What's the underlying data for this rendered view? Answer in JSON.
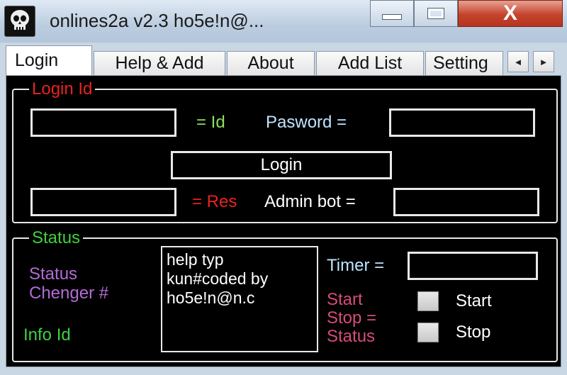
{
  "window": {
    "title": "onlines2a v2.3 ho5e!n@...",
    "icon": "skull-icon",
    "buttons": {
      "minimize": "minimize-icon",
      "maximize": "maximize-icon",
      "close": "X"
    }
  },
  "tabs": [
    {
      "label": "Login",
      "active": true
    },
    {
      "label": "Help & Add",
      "active": false
    },
    {
      "label": "About",
      "active": false
    },
    {
      "label": "Add List",
      "active": false
    },
    {
      "label": "Setting",
      "active": false
    }
  ],
  "tab_scroll": {
    "left": "◄",
    "right": "►"
  },
  "login_group": {
    "legend": "Login Id",
    "id_input": "",
    "id_label": "= Id",
    "password_label": "Pasword =",
    "password_input": "",
    "login_button": "Login",
    "res_input": "",
    "res_label": "= Res",
    "admin_label": "Admin bot =",
    "admin_input": ""
  },
  "status_group": {
    "legend": "Status",
    "status_changer_line1": "Status",
    "status_changer_line2": "Chenger #",
    "info_label": "Info Id",
    "memo_lines": [
      "help typ",
      "kun#coded by",
      "ho5e!n@n.c"
    ],
    "timer_label": "Timer =",
    "timer_input": "",
    "start_stop_line1": "Start",
    "start_stop_line2": "Stop =",
    "start_stop_line3": "Status",
    "start_checkbox_label": "Start",
    "stop_checkbox_label": "Stop"
  },
  "colors": {
    "legend_red": "#e8231e",
    "green": "#3fd13f",
    "id_green": "#8be05a",
    "purple": "#b46bd6",
    "pink": "#d84b7a",
    "label_blue": "#bfe4ff",
    "white": "#ffffff"
  }
}
